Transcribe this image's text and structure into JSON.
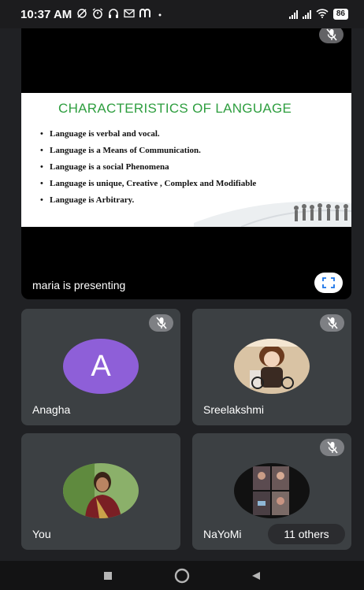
{
  "status_bar": {
    "time": "10:37 AM",
    "left_icons": [
      "whatsapp-muted-icon",
      "alarm-icon",
      "headphones-icon",
      "gmail-icon",
      "m-app-icon",
      "dot-icon"
    ],
    "battery": "86"
  },
  "presentation": {
    "slide_title": "CHARACTERISTICS OF LANGUAGE",
    "bullets": [
      "Language is verbal and vocal.",
      "Language is a Means of Communication.",
      "Language is a social Phenomena",
      "Language is unique, Creative , Complex and Modifiable",
      "Language is  Arbitrary."
    ],
    "presenting_label": "maria is presenting"
  },
  "participants": [
    {
      "name": "Anagha",
      "avatar_letter": "A",
      "avatar_color": "#8e5fd8",
      "muted": true
    },
    {
      "name": "Sreelakshmi",
      "muted": true
    },
    {
      "name": "You",
      "muted": false
    },
    {
      "name": "NaYoMi",
      "muted": true
    }
  ],
  "others_label": "11 others",
  "colors": {
    "background": "#202124",
    "tile": "#3c4043",
    "slide_title_green": "#2e9e3f"
  },
  "nav_icons": [
    "recents-square-icon",
    "home-circle-icon",
    "back-triangle-icon"
  ]
}
